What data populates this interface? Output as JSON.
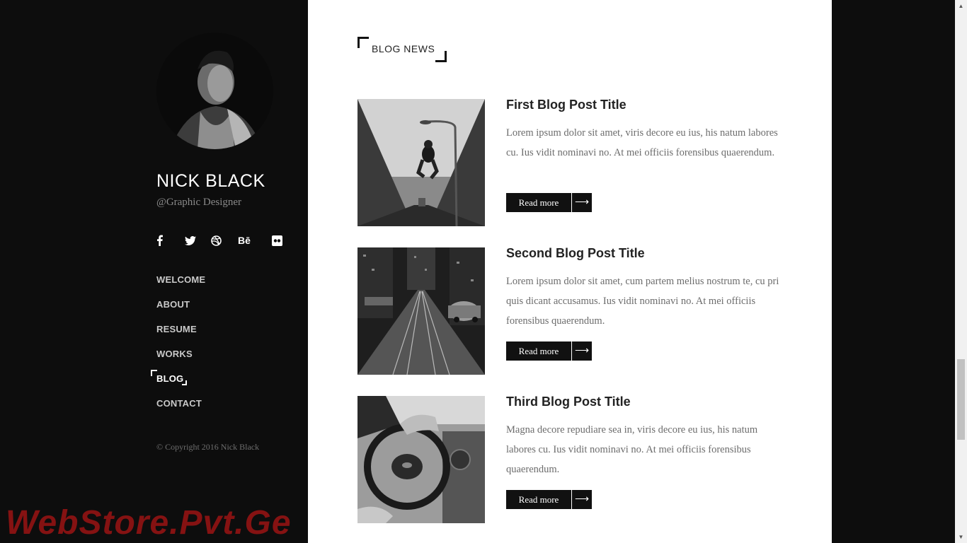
{
  "profile": {
    "name": "NICK BLACK",
    "role": "@Graphic Designer"
  },
  "socials": [
    {
      "icon": "facebook-icon",
      "glyph": "f"
    },
    {
      "icon": "twitter-icon",
      "glyph": "t"
    },
    {
      "icon": "dribbble-icon",
      "glyph": "d"
    },
    {
      "icon": "behance-icon",
      "glyph": "Bē"
    },
    {
      "icon": "flickr-icon",
      "glyph": "••"
    }
  ],
  "nav": [
    {
      "label": "WELCOME",
      "active": false
    },
    {
      "label": "ABOUT",
      "active": false
    },
    {
      "label": "RESUME",
      "active": false
    },
    {
      "label": "WORKS",
      "active": false
    },
    {
      "label": "BLOG",
      "active": true
    },
    {
      "label": "CONTACT",
      "active": false
    }
  ],
  "copyright": "© Copyright 2016 Nick Black",
  "watermark": "WebStore.Pvt.Ge",
  "blog": {
    "section_title": "BLOG NEWS",
    "posts": [
      {
        "title": "First Blog Post Title",
        "excerpt": "Lorem ipsum dolor sit amet, viris decore eu ius, his natum labores cu. Ius vidit nominavi no. At mei officiis forensibus quaerendum.",
        "read_more": "Read more"
      },
      {
        "title": "Second Blog Post Title",
        "excerpt": "Lorem ipsum dolor sit amet, cum partem melius nostrum te, cu pri quis dicant accusamus. Ius vidit nominavi no. At mei officiis forensibus quaerendum.",
        "read_more": "Read more"
      },
      {
        "title": "Third Blog Post Title",
        "excerpt": "Magna decore repudiare sea in, viris decore eu ius, his natum labores cu. Ius vidit nominavi no. At mei officiis forensibus quaerendum.",
        "read_more": "Read more"
      }
    ]
  },
  "colors": {
    "sidebar_bg": "#0d0d0d",
    "content_bg": "#ffffff",
    "button_bg": "#111111",
    "watermark": "#9a1414"
  }
}
